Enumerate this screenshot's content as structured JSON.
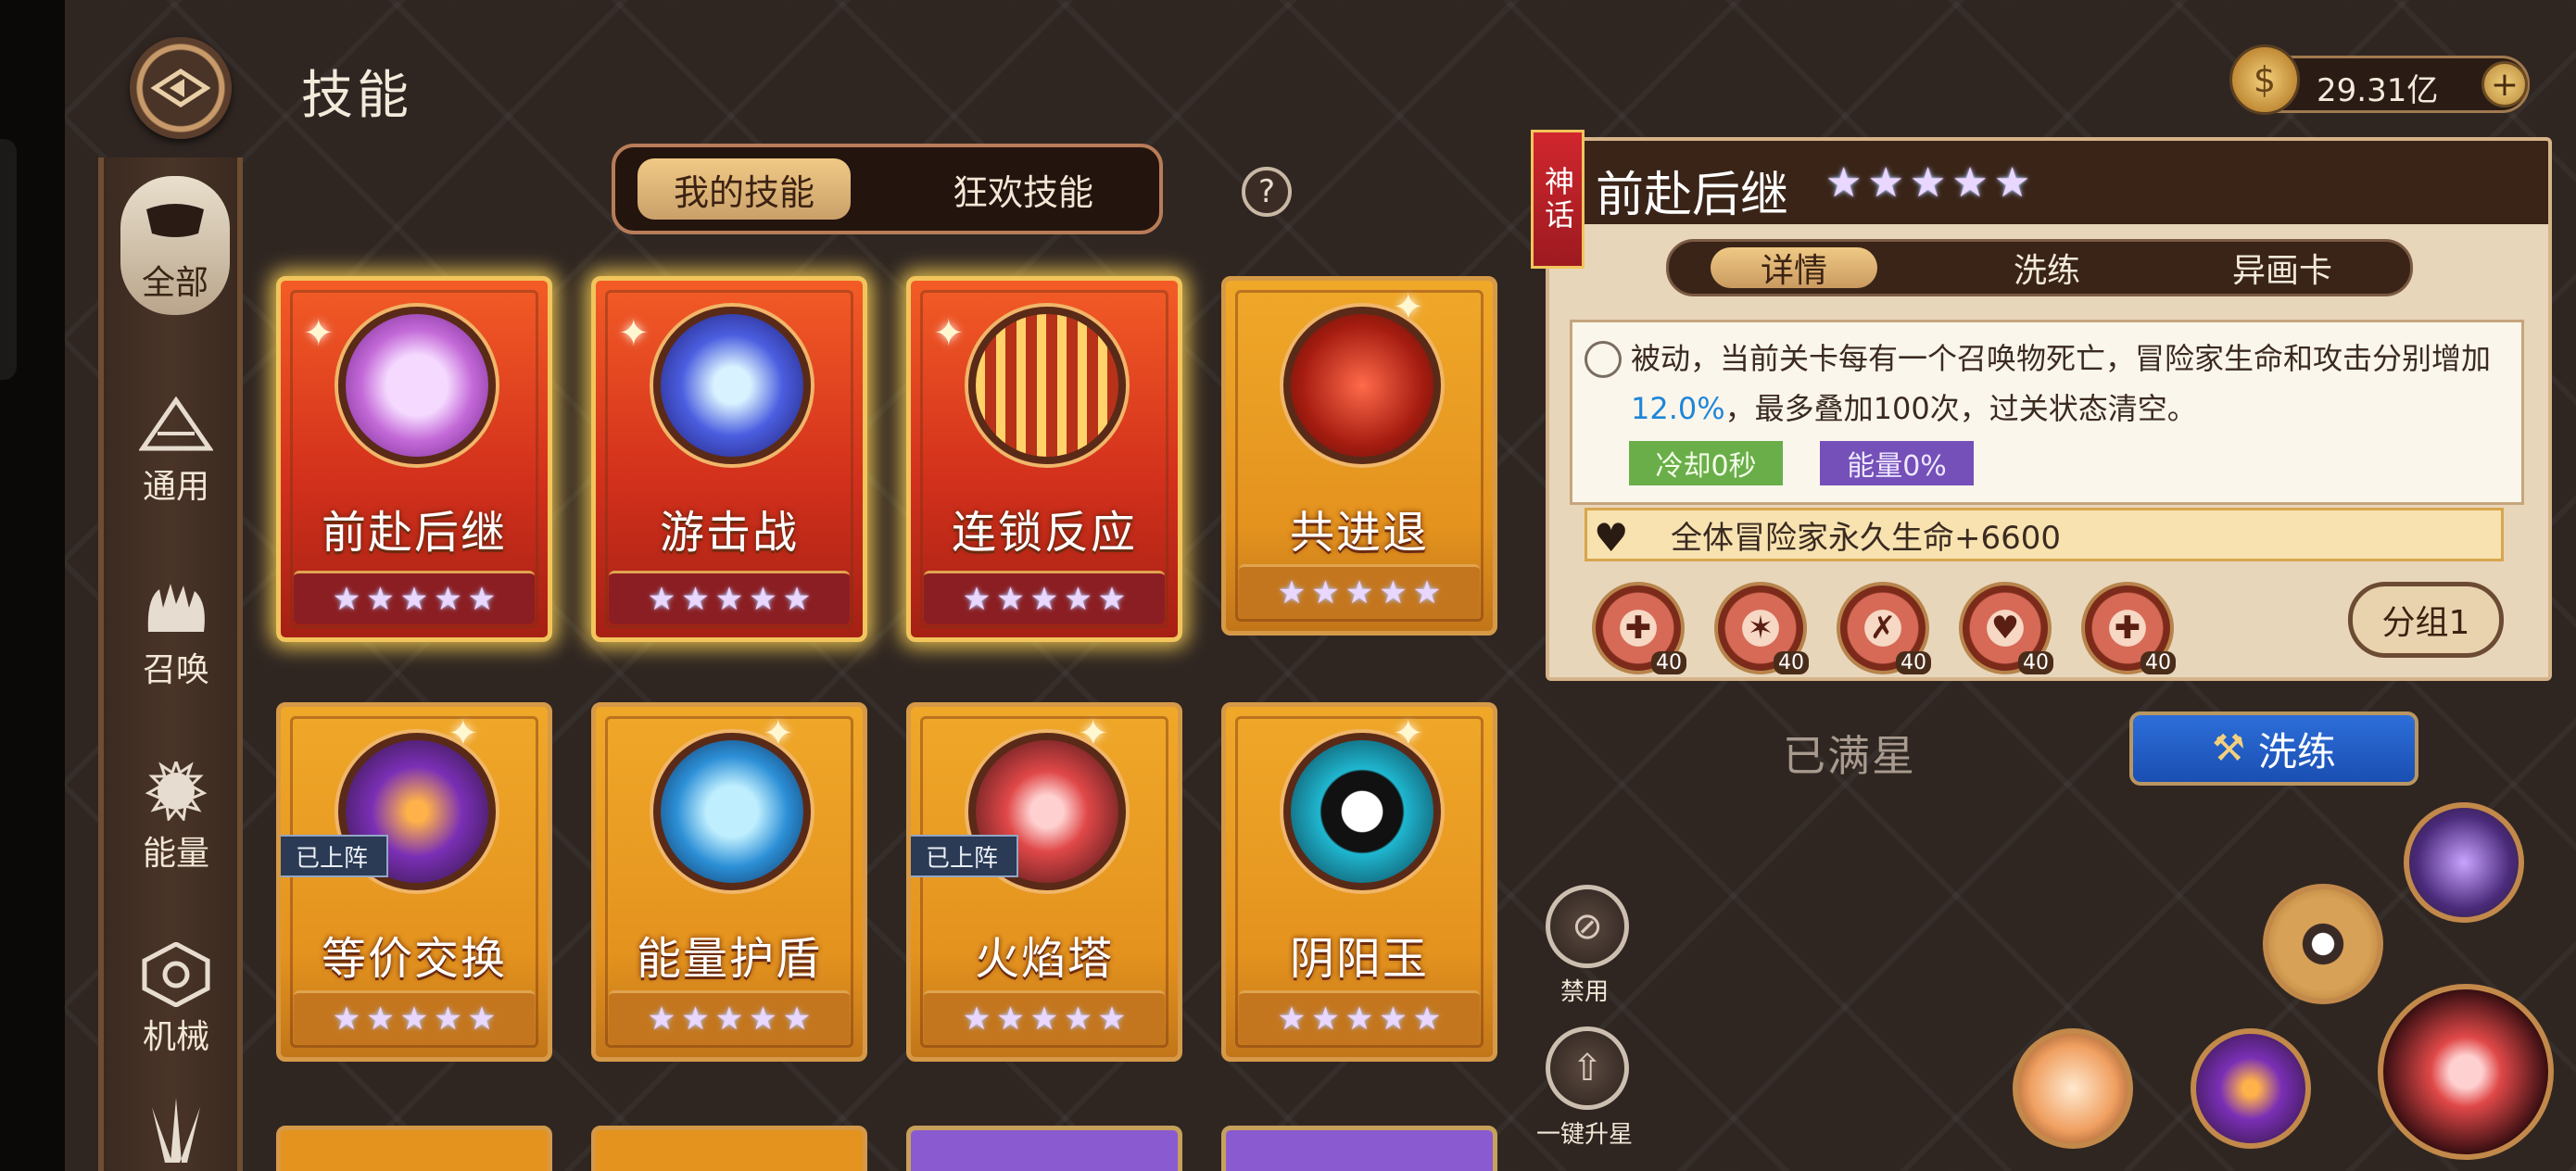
{
  "header": {
    "title": "技能",
    "back_icon": "back-arrow-icon"
  },
  "currency": {
    "gold_value": "29.31亿",
    "plus_label": "+",
    "coin_glyph": "$"
  },
  "sidebar": {
    "items": [
      {
        "label": "全部",
        "icon": "all-icon",
        "active": true
      },
      {
        "label": "通用",
        "icon": "general-icon",
        "active": false
      },
      {
        "label": "召唤",
        "icon": "summon-icon",
        "active": false
      },
      {
        "label": "能量",
        "icon": "energy-icon",
        "active": false
      },
      {
        "label": "机械",
        "icon": "machine-icon",
        "active": false
      }
    ]
  },
  "tabs": {
    "mine": "我的技能",
    "carnival": "狂欢技能",
    "help": "?"
  },
  "cards": [
    {
      "name": "前赴后继",
      "stars": 5,
      "style": "red",
      "deployed": ""
    },
    {
      "name": "游击战",
      "stars": 5,
      "style": "red",
      "deployed": ""
    },
    {
      "name": "连锁反应",
      "stars": 5,
      "style": "red",
      "deployed": ""
    },
    {
      "name": "共进退",
      "stars": 5,
      "style": "gold",
      "deployed": ""
    },
    {
      "name": "等价交换",
      "stars": 5,
      "style": "gold",
      "deployed": "已上阵"
    },
    {
      "name": "能量护盾",
      "stars": 5,
      "style": "gold",
      "deployed": ""
    },
    {
      "name": "火焰塔",
      "stars": 5,
      "style": "gold",
      "deployed": "已上阵"
    },
    {
      "name": "阴阳玉",
      "stars": 5,
      "style": "gold",
      "deployed": ""
    }
  ],
  "detail": {
    "rarity": "神话",
    "title": "前赴后继",
    "stars": 5,
    "tabs": {
      "detail": "详情",
      "refine": "洗练",
      "card": "异画卡"
    },
    "desc_part1": "被动，当前关卡每有一个召唤物死亡，冒险家生命和攻击分别增加",
    "desc_highlight": "12.0%",
    "desc_part2": "，最多叠加100次，过关状态清空。",
    "cooldown": "冷却0秒",
    "energy": "能量0%",
    "bonus": "全体冒险家永久生命+6600",
    "sub_levels": [
      "40",
      "40",
      "40",
      "40",
      "40"
    ],
    "group_label": "分组1",
    "full_star": "已满星",
    "refine_label": "洗练"
  },
  "side_actions": {
    "ban": "禁用",
    "upgrade_all": "一键升星"
  },
  "colors": {
    "accent_blue": "#1f86d8",
    "cooldown_green": "#6aae4a",
    "energy_purple": "#7450b8",
    "myth_red": "#d1262e"
  }
}
